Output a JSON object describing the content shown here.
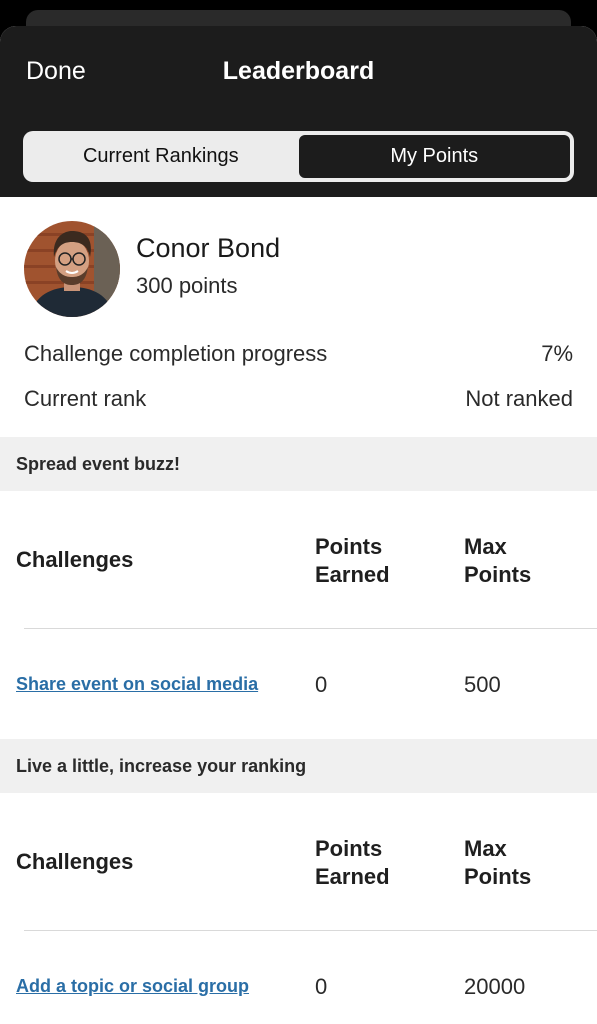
{
  "header": {
    "done_label": "Done",
    "title": "Leaderboard",
    "tabs": [
      {
        "label": "Current Rankings",
        "selected": false
      },
      {
        "label": "My Points",
        "selected": true
      }
    ]
  },
  "profile": {
    "name": "Conor Bond",
    "points": "300 points",
    "stats": [
      {
        "label": "Challenge completion progress",
        "value": "7%"
      },
      {
        "label": "Current rank",
        "value": "Not ranked"
      }
    ]
  },
  "sections": [
    {
      "title": "Spread event buzz!",
      "columns": {
        "challenges": "Challenges",
        "earned": "Points Earned",
        "max": "Max Points"
      },
      "rows": [
        {
          "challenge": "Share event on social media",
          "earned": "0",
          "max": "500"
        }
      ]
    },
    {
      "title": "Live a little, increase your ranking",
      "columns": {
        "challenges": "Challenges",
        "earned": "Points Earned",
        "max": "Max Points"
      },
      "rows": [
        {
          "challenge": "Add a topic or social group",
          "earned": "0",
          "max": "20000"
        }
      ]
    }
  ],
  "colors": {
    "header_bg": "#1c1c1c",
    "link": "#2a6ea6",
    "section_bg": "#f0f0f0"
  }
}
